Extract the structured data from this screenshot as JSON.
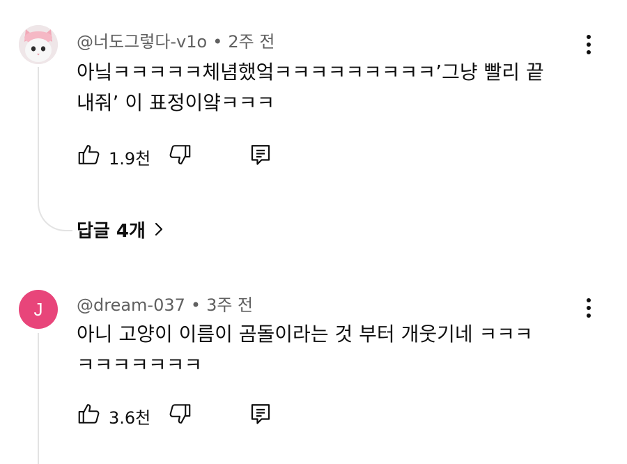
{
  "comments": [
    {
      "author": "@너도그렇다-v1o",
      "time": "2주 전",
      "text_line1": "아닠ㅋㅋㅋㅋㅋ체념했엌ㅋㅋㅋㅋㅋㅋㅋㅋㅋ’그냥 빨리 끝",
      "text_line2": "내줘’ 이 표정이얔ㅋㅋㅋ",
      "likes": "1.9천",
      "replies_label": "답글 4개",
      "avatar_icon": "cat-avatar-icon"
    },
    {
      "author": "@dream-037",
      "time": "3주 전",
      "avatar_letter": "J",
      "avatar_color": "#e8457a",
      "text_line1": "아니 고양이 이름이 곰돌이라는 것 부터 개웃기네 ㅋㅋㅋ",
      "text_line2": "ㅋㅋㅋㅋㅋㅋㅋ",
      "likes": "3.6천"
    }
  ],
  "separator": "•",
  "icons": {
    "like": "thumb-up-icon",
    "dislike": "thumb-down-icon",
    "reply": "reply-icon",
    "more": "more-vertical-icon",
    "chevron": "chevron-right-icon"
  }
}
